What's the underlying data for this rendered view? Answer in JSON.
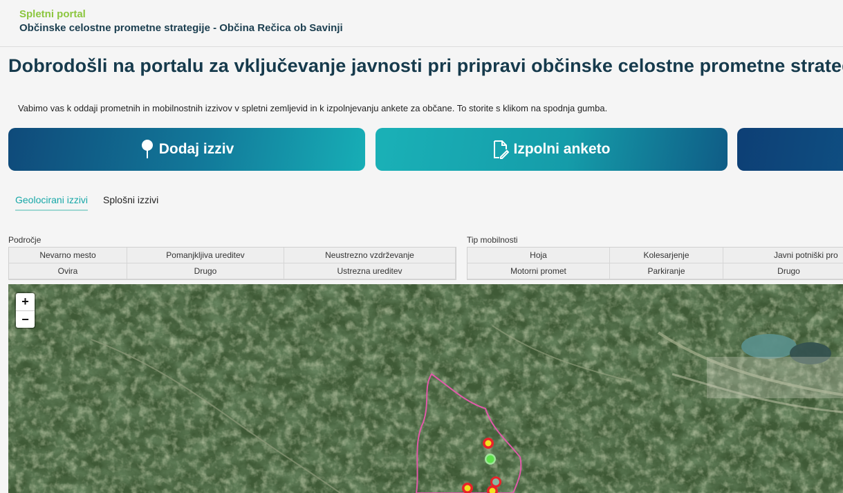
{
  "header": {
    "brand": "Spletni portal",
    "subtitle": "Občinske celostne prometne strategije - Občina Rečica ob Savinji"
  },
  "main": {
    "headline": "Dobrodošli na portalu za vključevanje javnosti pri pripravi občinske celostne prometne strategije!",
    "intro": "Vabimo vas k oddaji prometnih in mobilnostnih izzivov v spletni zemljevid in k izpolnjevanju ankete za občane. To storite s klikom na spodnja gumba.",
    "buttons": {
      "add_challenge": "Dodaj izziv",
      "fill_survey": "Izpolni anketo"
    },
    "tabs": [
      "Geolocirani izzivi",
      "Splošni izzivi"
    ]
  },
  "filters": {
    "area": {
      "label": "Področje",
      "options": [
        "Nevarno mesto",
        "Pomanjkljiva ureditev",
        "Neustrezno vzdrževanje",
        "Ovira",
        "Drugo",
        "Ustrezna ureditev"
      ]
    },
    "mobility": {
      "label": "Tip mobilnosti",
      "options": [
        "Hoja",
        "Kolesarjenje",
        "Javni potniški pro",
        "Motorni promet",
        "Parkiranje",
        "Drugo"
      ]
    }
  },
  "map": {
    "zoom_in": "+",
    "zoom_out": "−",
    "markers": [
      {
        "status": "red-yellow"
      },
      {
        "status": "green"
      },
      {
        "status": "gray-green"
      },
      {
        "status": "red-yellow"
      },
      {
        "status": "red-yellow"
      }
    ],
    "colors": {
      "boundary": "#e05aa9",
      "marker_red": "#e8232a",
      "marker_yellow": "#f3e21f",
      "marker_green": "#5fe04b"
    }
  },
  "colors": {
    "brand": "#8cc63f",
    "title": "#163a4c",
    "accent": "#16a7a7"
  }
}
